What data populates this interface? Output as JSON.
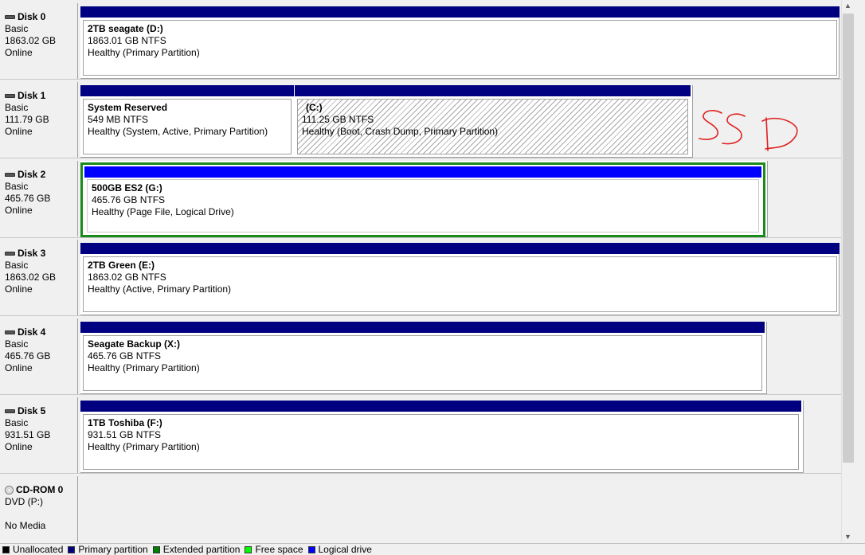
{
  "disks": [
    {
      "name": "Disk 0",
      "type": "Basic",
      "size": "1863.02 GB",
      "status": "Online",
      "partitions": [
        {
          "name": "2TB seagate  (D:)",
          "size": "1863.01 GB NTFS",
          "status": "Healthy (Primary Partition)"
        }
      ]
    },
    {
      "name": "Disk 1",
      "type": "Basic",
      "size": "111.79 GB",
      "status": "Online",
      "partitions": [
        {
          "name": "System Reserved",
          "size": "549 MB NTFS",
          "status": "Healthy (System, Active, Primary Partition)"
        },
        {
          "name": "(C:)",
          "size": "111.25 GB NTFS",
          "status": "Healthy (Boot, Crash Dump, Primary Partition)"
        }
      ]
    },
    {
      "name": "Disk 2",
      "type": "Basic",
      "size": "465.76 GB",
      "status": "Online",
      "partitions": [
        {
          "name": "500GB ES2  (G:)",
          "size": "465.76 GB NTFS",
          "status": "Healthy (Page File, Logical Drive)"
        }
      ]
    },
    {
      "name": "Disk 3",
      "type": "Basic",
      "size": "1863.02 GB",
      "status": "Online",
      "partitions": [
        {
          "name": "2TB Green  (E:)",
          "size": "1863.02 GB NTFS",
          "status": "Healthy (Active, Primary Partition)"
        }
      ]
    },
    {
      "name": "Disk 4",
      "type": "Basic",
      "size": "465.76 GB",
      "status": "Online",
      "partitions": [
        {
          "name": "Seagate Backup  (X:)",
          "size": "465.76 GB NTFS",
          "status": "Healthy (Primary Partition)"
        }
      ]
    },
    {
      "name": "Disk 5",
      "type": "Basic",
      "size": "931.51 GB",
      "status": "Online",
      "partitions": [
        {
          "name": "1TB Toshiba  (F:)",
          "size": "931.51 GB NTFS",
          "status": "Healthy (Primary Partition)"
        }
      ]
    }
  ],
  "cdrom": {
    "name": "CD-ROM 0",
    "type": "DVD (P:)",
    "status": "No Media"
  },
  "annotation": {
    "text": "SSD",
    "color": "#e02020"
  },
  "legend": [
    {
      "label": "Unallocated",
      "color": "#000000"
    },
    {
      "label": "Primary partition",
      "color": "#000080"
    },
    {
      "label": "Extended partition",
      "color": "#008000"
    },
    {
      "label": "Free space",
      "color": "#00ff00"
    },
    {
      "label": "Logical drive",
      "color": "#0000ff"
    }
  ]
}
